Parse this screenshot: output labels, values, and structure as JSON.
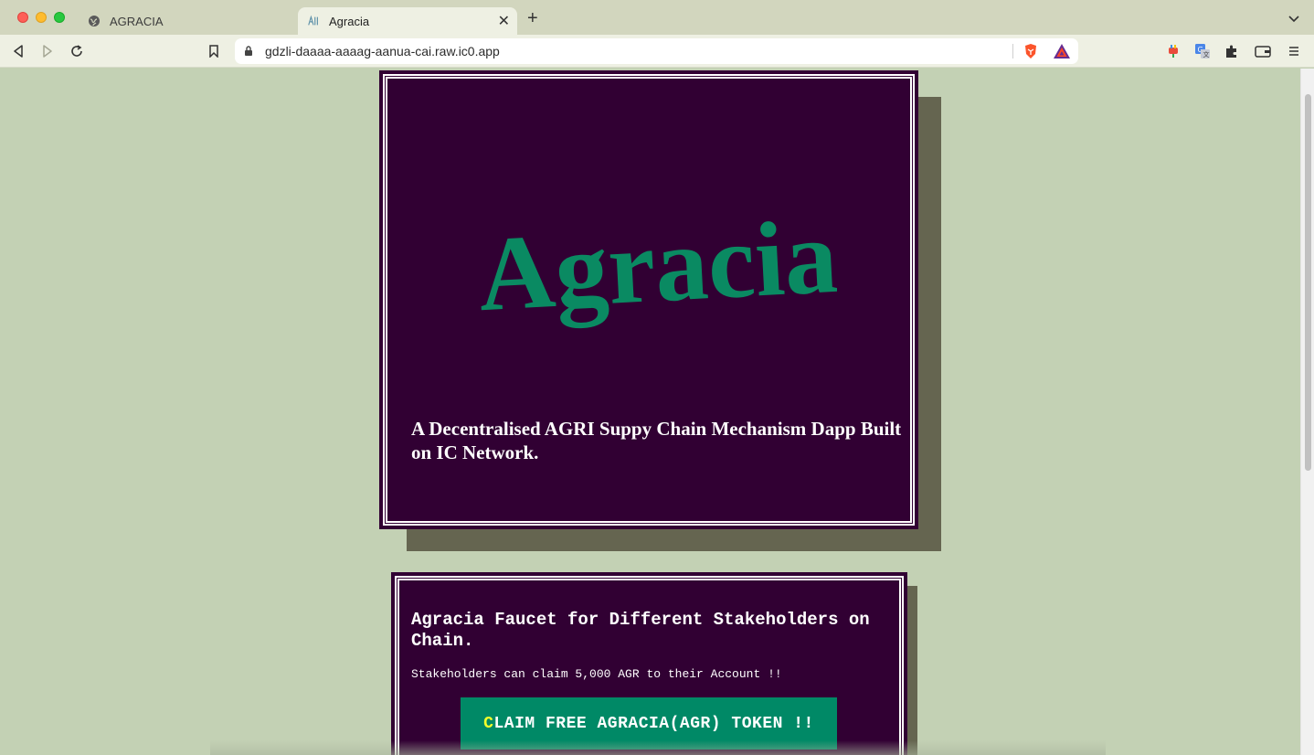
{
  "browser": {
    "tabs": [
      {
        "title": "AGRACIA",
        "active": false,
        "icon": "globe-icon"
      },
      {
        "title": "Agracia",
        "active": true,
        "icon": "agracia-favicon"
      }
    ],
    "url": "gdzli-daaaa-aaaag-aanua-cai.raw.ic0.app"
  },
  "hero": {
    "logo_text": "Agracia",
    "tagline": "A Decentralised AGRI Suppy Chain Mechanism Dapp Built on IC Network."
  },
  "faucet": {
    "title": "Agracia Faucet for Different Stakeholders on Chain.",
    "description": "Stakeholders can claim 5,000 AGR to their Account !!",
    "button_first_letter": "C",
    "button_rest": "LAIM FREE AGRACIA(AGR) TOKEN !!"
  },
  "colors": {
    "page_bg": "#c3d1b4",
    "card_bg": "#310033",
    "accent_green": "#008966",
    "logo_green": "#0a8a62",
    "highlight_yellow": "#f3ff2a"
  }
}
